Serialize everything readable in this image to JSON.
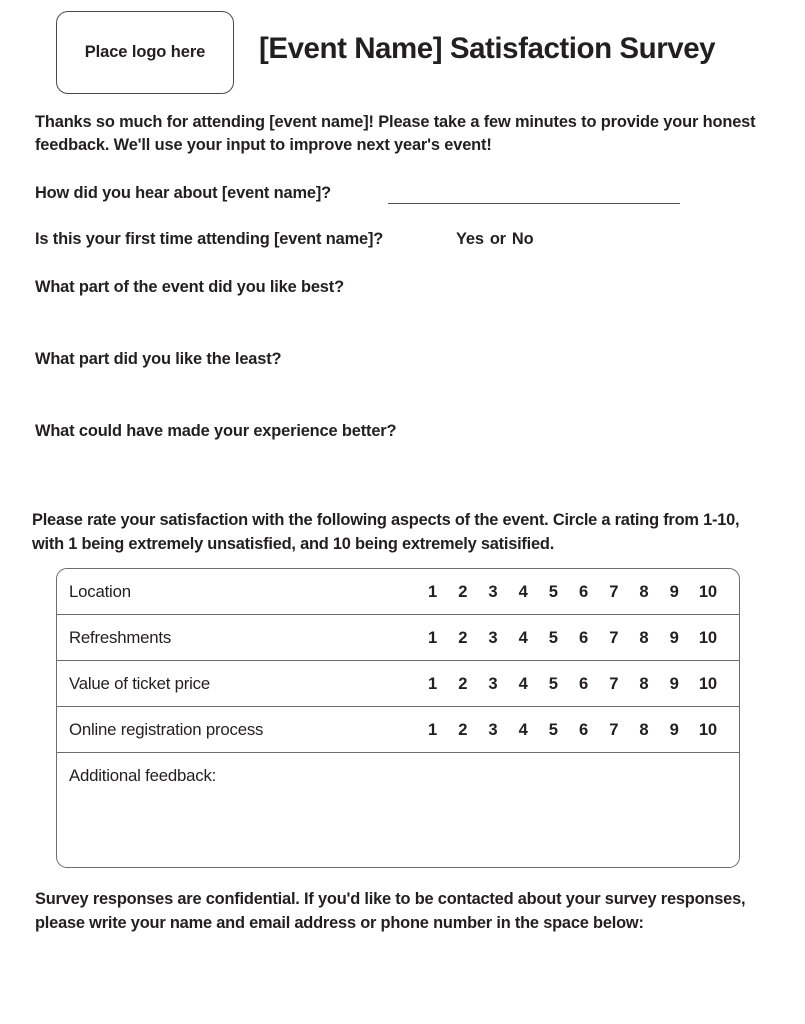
{
  "header": {
    "logo_placeholder": "Place logo here",
    "title": "[Event Name] Satisfaction Survey"
  },
  "intro": {
    "paragraph": "Thanks so much for attending [event name]! Please take a few minutes to provide your honest feedback. We'll use your input to improve next year's event!"
  },
  "questions": {
    "hear_about": "How did you hear about [event name]? ",
    "first_time": "Is this your first time attending [event name]?",
    "first_time_options": {
      "yes": "Yes",
      "separator": "or",
      "no": "No"
    },
    "liked_best": "What part of the event did you like best?",
    "liked_least": "What part did you like the least?",
    "improvement": "What could have made your experience better?"
  },
  "rating_section": {
    "instructions": "Please rate your satisfaction with the following aspects of the event. Circle a rating from 1-10, with 1 being extremely unsatisfied, and 10 being extremely satisified.",
    "scale": [
      "1",
      "2",
      "3",
      "4",
      "5",
      "6",
      "7",
      "8",
      "9",
      "10"
    ],
    "rows": [
      {
        "label": "Location"
      },
      {
        "label": "Refreshments"
      },
      {
        "label": "Value of ticket price"
      },
      {
        "label": "Online registration process"
      }
    ],
    "feedback_row": {
      "label": "Additional feedback:"
    }
  },
  "footer": {
    "confidentiality_note": "Survey responses are confidential. If you'd like to be contacted about your survey responses, please write your name and email address or phone number in the space below:"
  },
  "colors": {
    "text": "#231f20",
    "border": "#6d6d6d",
    "rule": "#55514f",
    "background": "#ffffff"
  }
}
